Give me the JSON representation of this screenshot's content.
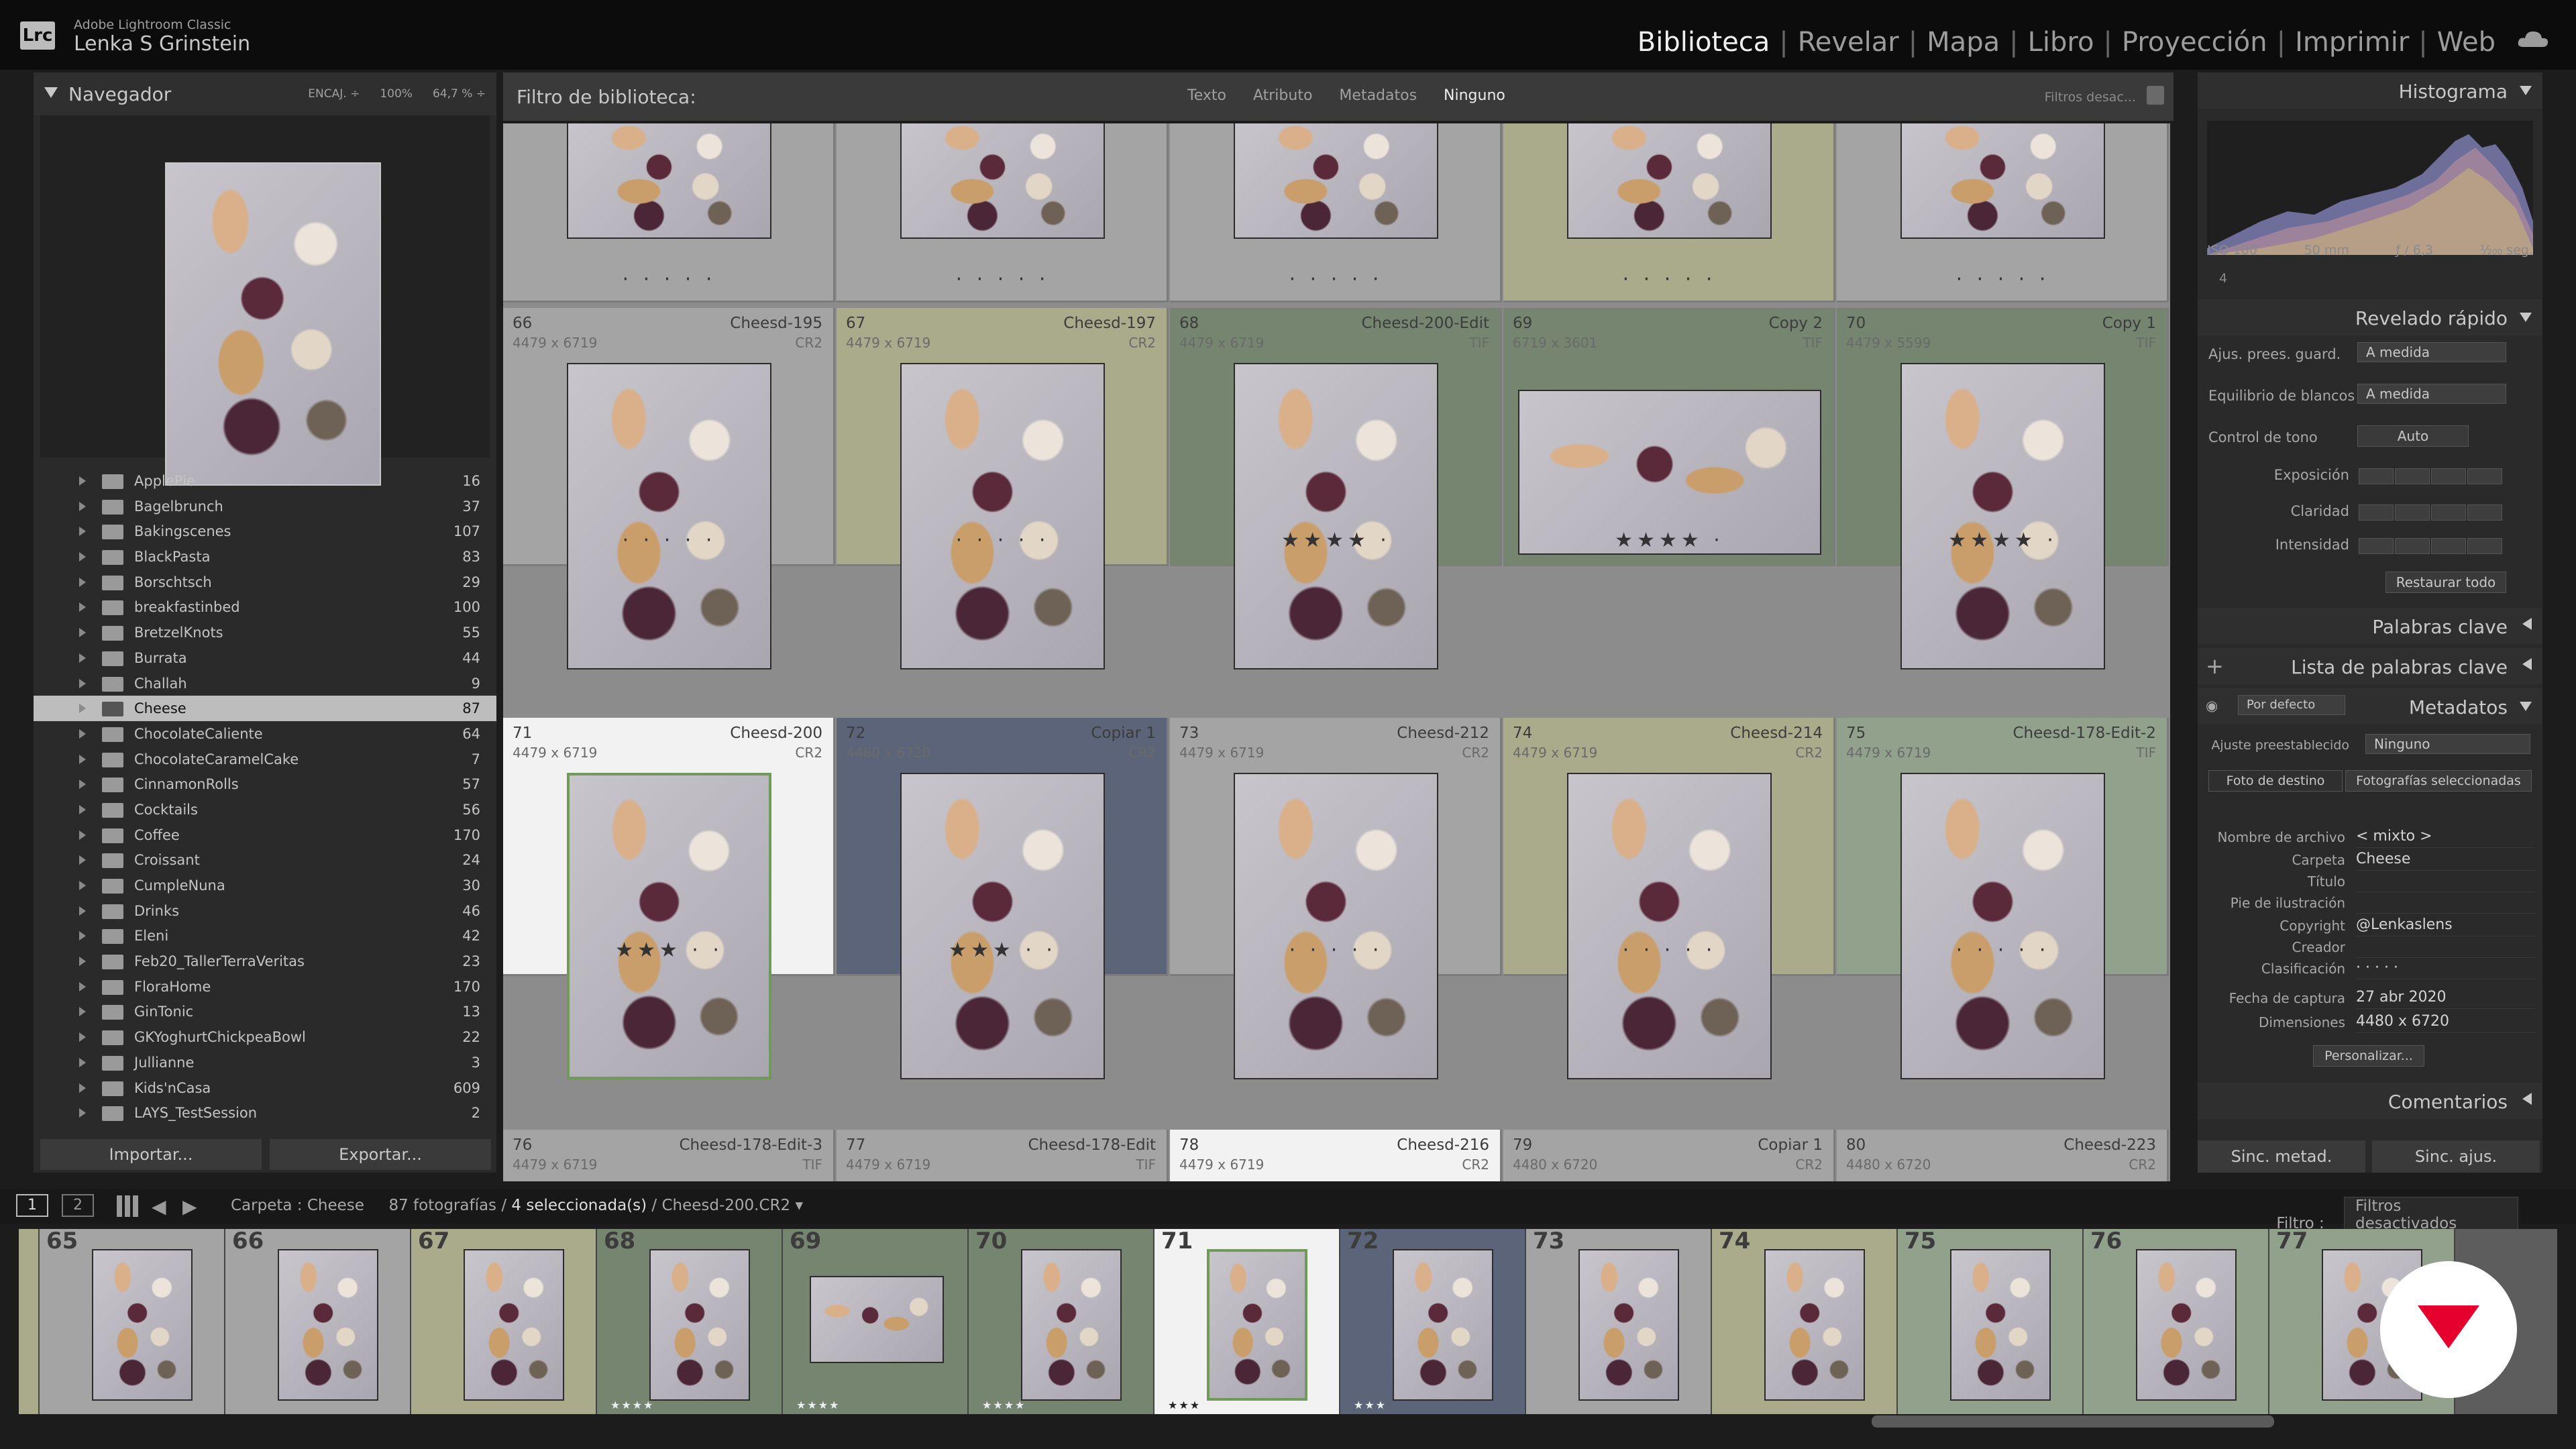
{
  "app": {
    "product": "Adobe Lightroom Classic",
    "user": "Lenka S Grinstein",
    "logo": "Lrc"
  },
  "modules": [
    {
      "label": "Biblioteca",
      "active": true
    },
    {
      "label": "Revelar"
    },
    {
      "label": "Mapa"
    },
    {
      "label": "Libro"
    },
    {
      "label": "Proyección"
    },
    {
      "label": "Imprimir"
    },
    {
      "label": "Web"
    }
  ],
  "navigator": {
    "title": "Navegador",
    "opt1": "ENCAJ. ÷",
    "opt2": "100%",
    "opt3": "64,7 % ÷"
  },
  "folders": [
    {
      "name": "ApplePie",
      "count": "16"
    },
    {
      "name": "Bagelbrunch",
      "count": "37"
    },
    {
      "name": "Bakingscenes",
      "count": "107"
    },
    {
      "name": "BlackPasta",
      "count": "83"
    },
    {
      "name": "Borschtsch",
      "count": "29"
    },
    {
      "name": "breakfastinbed",
      "count": "100"
    },
    {
      "name": "BretzelKnots",
      "count": "55"
    },
    {
      "name": "Burrata",
      "count": "44"
    },
    {
      "name": "Challah",
      "count": "9"
    },
    {
      "name": "Cheese",
      "count": "87",
      "selected": true
    },
    {
      "name": "ChocolateCaliente",
      "count": "64"
    },
    {
      "name": "ChocolateCaramelCake",
      "count": "7"
    },
    {
      "name": "CinnamonRolls",
      "count": "57"
    },
    {
      "name": "Cocktails",
      "count": "56"
    },
    {
      "name": "Coffee",
      "count": "170"
    },
    {
      "name": "Croissant",
      "count": "24"
    },
    {
      "name": "CumpleNuna",
      "count": "30"
    },
    {
      "name": "Drinks",
      "count": "46"
    },
    {
      "name": "Eleni",
      "count": "42"
    },
    {
      "name": "Feb20_TallerTerraVeritas",
      "count": "23"
    },
    {
      "name": "FloraHome",
      "count": "170"
    },
    {
      "name": "GinTonic",
      "count": "13"
    },
    {
      "name": "GKYoghurtChickpeaBowl",
      "count": "22"
    },
    {
      "name": "Jullianne",
      "count": "3"
    },
    {
      "name": "Kids'nCasa",
      "count": "609"
    },
    {
      "name": "LAYS_TestSession",
      "count": "2"
    }
  ],
  "buttons": {
    "import": "Importar...",
    "export": "Exportar...",
    "sync_meta": "Sinc. metad.",
    "sync_settings": "Sinc. ajus."
  },
  "filter": {
    "title": "Filtro de biblioteca:",
    "tabs": [
      "Texto",
      "Atributo",
      "Metadatos",
      "Ninguno"
    ],
    "status": "Filtros desac..."
  },
  "grid": {
    "top_row": [
      {
        "bg": "#a4a4a4"
      },
      {
        "bg": "#a4a4a4"
      },
      {
        "bg": "#a4a4a4"
      },
      {
        "bg": "#a9ab8a"
      },
      {
        "bg": "#a4a4a4"
      }
    ],
    "row2": [
      {
        "idx": "66",
        "name": "Cheesd-195",
        "dims": "4479 x 6719",
        "ext": "CR2",
        "bg": "#a4a4a4",
        "stars": "· · · · ·"
      },
      {
        "idx": "67",
        "name": "Cheesd-197",
        "dims": "4479 x 6719",
        "ext": "CR2",
        "bg": "#a9ab8a",
        "stars": "· · · · ·"
      },
      {
        "idx": "68",
        "name": "Cheesd-200-Edit",
        "dims": "4479 x 6719",
        "ext": "TIF",
        "bg": "#76856f",
        "stars": "★★★★ ·"
      },
      {
        "idx": "69",
        "name": "Copy 2",
        "dims": "6719 x 3601",
        "ext": "TIF",
        "bg": "#76856f",
        "stars": "★★★★ ·",
        "wide": true
      },
      {
        "idx": "70",
        "name": "Copy 1",
        "dims": "4479 x 5599",
        "ext": "TIF",
        "bg": "#76856f",
        "stars": "★★★★ ·"
      }
    ],
    "row3": [
      {
        "idx": "71",
        "name": "Cheesd-200",
        "dims": "4479 x 6719",
        "ext": "CR2",
        "bg": "#f2f2f2",
        "stars": "★★★ · ·"
      },
      {
        "idx": "72",
        "name": "Copiar 1",
        "dims": "4480 x 6720",
        "ext": "CR2",
        "bg": "#5b6478",
        "stars": "★★★ · ·"
      },
      {
        "idx": "73",
        "name": "Cheesd-212",
        "dims": "4479 x 6719",
        "ext": "CR2",
        "bg": "#a4a4a4",
        "stars": "· · · · ·"
      },
      {
        "idx": "74",
        "name": "Cheesd-214",
        "dims": "4479 x 6719",
        "ext": "CR2",
        "bg": "#a9ab8a",
        "stars": "· · · · ·"
      },
      {
        "idx": "75",
        "name": "Cheesd-178-Edit-2",
        "dims": "4479 x 6719",
        "ext": "TIF",
        "bg": "#91a18c",
        "stars": "· · · · ·"
      }
    ],
    "row4": [
      {
        "idx": "76",
        "name": "Cheesd-178-Edit-3",
        "dims": "4479 x 6719",
        "ext": "TIF",
        "bg": "#a4a4a4"
      },
      {
        "idx": "77",
        "name": "Cheesd-178-Edit",
        "dims": "4479 x 6719",
        "ext": "TIF",
        "bg": "#a4a4a4"
      },
      {
        "idx": "78",
        "name": "Cheesd-216",
        "dims": "4479 x 6719",
        "ext": "CR2",
        "bg": "#f2f2f2"
      },
      {
        "idx": "79",
        "name": "Copiar 1",
        "dims": "4480 x 6720",
        "ext": "CR2",
        "bg": "#a4a4a4"
      },
      {
        "idx": "80",
        "name": "Cheesd-223",
        "dims": "4480 x 6720",
        "ext": "CR2",
        "bg": "#a4a4a4"
      }
    ]
  },
  "histogram": {
    "title": "Histograma",
    "iso": "ISO 100",
    "focal": "50 mm",
    "aperture": "ƒ / 6,3",
    "shutter": "¹⁄₂₀₀ seg.",
    "count": "4"
  },
  "quick_develop": {
    "title": "Revelado rápido",
    "preset_label": "Ajus. prees. guard.",
    "preset_value": "A medida",
    "wb_label": "Equilibrio de blancos",
    "wb_value": "A medida",
    "tone_label": "Control de tono",
    "auto": "Auto",
    "exposure": "Exposición",
    "clarity": "Claridad",
    "vibrance": "Intensidad",
    "reset": "Restaurar todo"
  },
  "keywords": {
    "title": "Palabras clave",
    "list_title": "Lista de palabras clave"
  },
  "metadata": {
    "title": "Metadatos",
    "preset_mode": "Por defecto",
    "preset_label": "Ajuste preestablecido",
    "preset_value": "Ninguno",
    "tab_target": "Foto de destino",
    "tab_selected": "Fotografías seleccionadas",
    "fields": [
      {
        "label": "Nombre de archivo",
        "value": "< mixto >"
      },
      {
        "label": "Carpeta",
        "value": "Cheese"
      },
      {
        "label": "Título",
        "value": ""
      },
      {
        "label": "Pie de ilustración",
        "value": ""
      },
      {
        "label": "Copyright",
        "value": "@Lenkaslens"
      },
      {
        "label": "Creador",
        "value": ""
      },
      {
        "label": "Clasificación",
        "value": "· · · · ·"
      },
      {
        "label": "Fecha de captura",
        "value": "27 abr 2020"
      },
      {
        "label": "Dimensiones",
        "value": "4480 x 6720"
      }
    ],
    "customize": "Personalizar..."
  },
  "comments": {
    "title": "Comentarios"
  },
  "filmbar": {
    "source": "Carpeta : Cheese",
    "count": "87 fotografías /",
    "selected": "4 seleccionada(s)",
    "current": "/ Cheesd-200.CR2 ▾",
    "filter_label": "Filtro :",
    "filter_value": "Filtros desactivados"
  },
  "filmstrip": [
    {
      "idx": "",
      "bg": "#a9ab8a"
    },
    {
      "idx": "65",
      "bg": "#a4a4a4"
    },
    {
      "idx": "66",
      "bg": "#a4a4a4"
    },
    {
      "idx": "67",
      "bg": "#a9ab8a"
    },
    {
      "idx": "68",
      "bg": "#76856f",
      "stars": "★★★★"
    },
    {
      "idx": "69",
      "bg": "#76856f",
      "stars": "★★★★",
      "wide": true
    },
    {
      "idx": "70",
      "bg": "#76856f",
      "stars": "★★★★"
    },
    {
      "idx": "71",
      "bg": "#f2f2f2",
      "stars": "★★★"
    },
    {
      "idx": "72",
      "bg": "#5b6478",
      "stars": "★★★"
    },
    {
      "idx": "73",
      "bg": "#a4a4a4"
    },
    {
      "idx": "74",
      "bg": "#a9ab8a"
    },
    {
      "idx": "75",
      "bg": "#91a18c"
    },
    {
      "idx": "76",
      "bg": "#91a18c"
    },
    {
      "idx": "77",
      "bg": "#91a18c"
    }
  ]
}
